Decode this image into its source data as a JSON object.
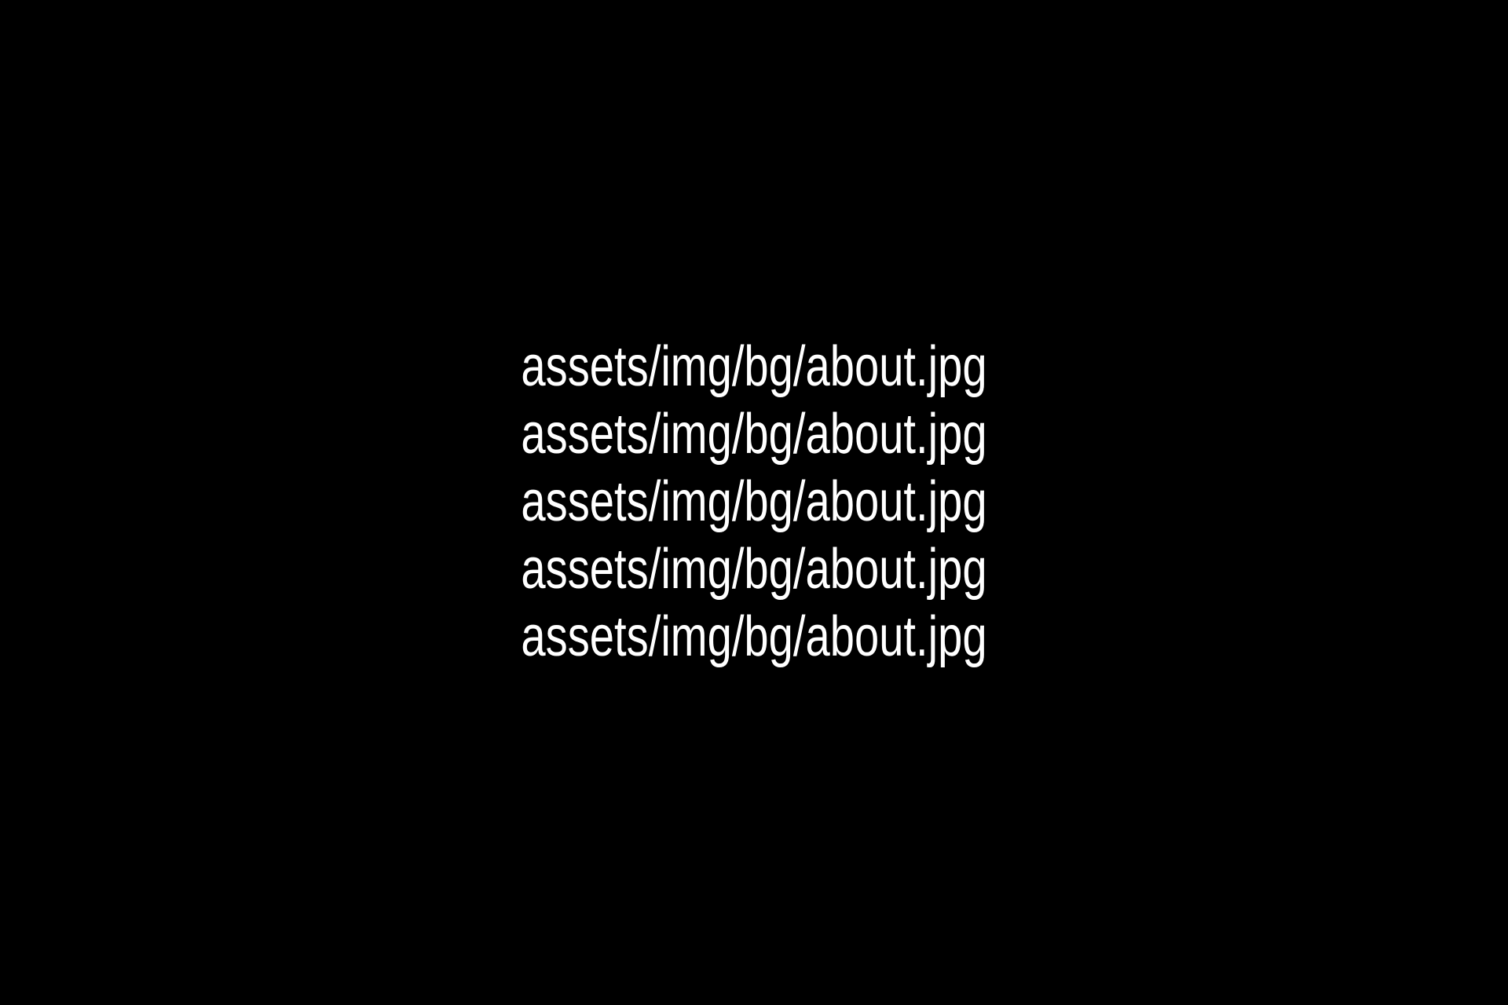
{
  "lines": [
    "assets/img/bg/about.jpg",
    "assets/img/bg/about.jpg",
    "assets/img/bg/about.jpg",
    "assets/img/bg/about.jpg",
    "assets/img/bg/about.jpg"
  ],
  "colors": {
    "background": "#000000",
    "text": "#ffffff"
  }
}
